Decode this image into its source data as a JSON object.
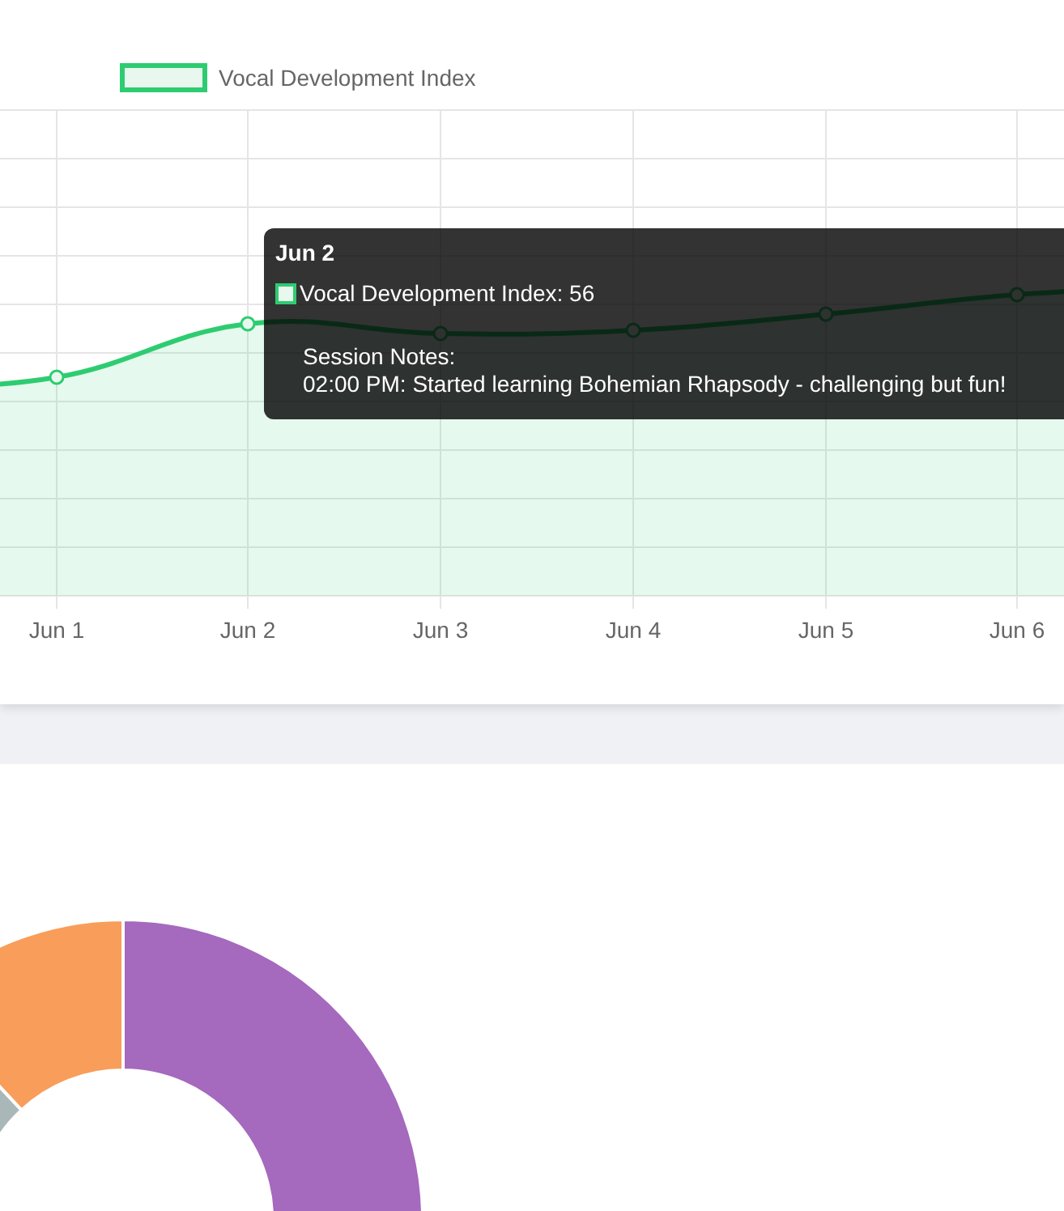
{
  "legend": {
    "label": "Vocal Development Index"
  },
  "x_labels": [
    "Jun 1",
    "Jun 2",
    "Jun 3",
    "Jun 4",
    "Jun 5",
    "Jun 6"
  ],
  "tooltip": {
    "title": "Jun 2",
    "label": "Vocal Development Index: 56",
    "notes_heading": "Session Notes:",
    "notes": [
      "02:00 PM: Started learning Bohemian Rhapsody - challenging but fun!"
    ]
  }
}
